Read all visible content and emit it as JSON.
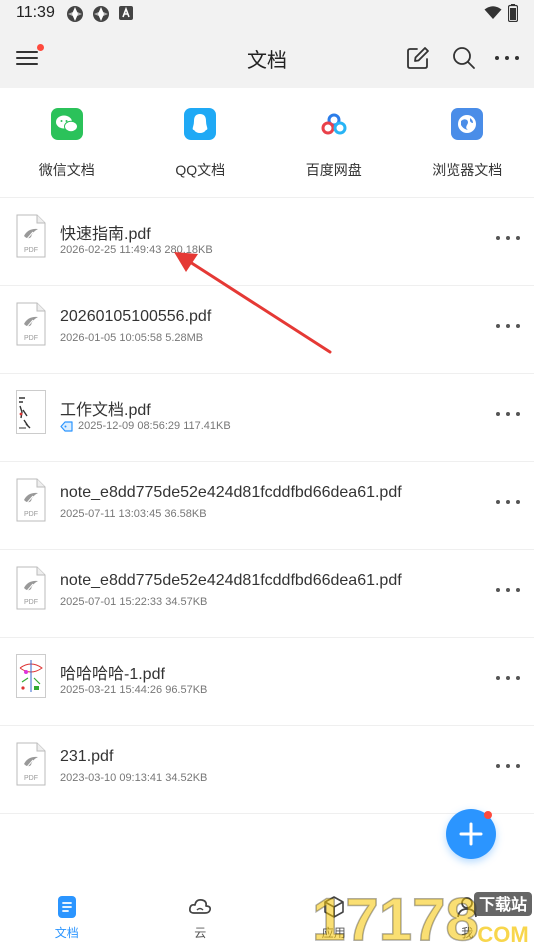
{
  "status_bar": {
    "time": "11:39",
    "left_icons": [
      "sync-icon",
      "sync-icon",
      "android-notification-icon"
    ],
    "right_icons": [
      "wifi-icon",
      "battery-icon"
    ]
  },
  "header": {
    "title": "文档",
    "actions": [
      "menu-icon",
      "edit-icon",
      "search-icon",
      "more-icon"
    ]
  },
  "sources": [
    {
      "label": "微信文档",
      "icon": "wechat-icon",
      "color": "#2bc25a"
    },
    {
      "label": "QQ文档",
      "icon": "qq-icon",
      "color": "#1fa9f5"
    },
    {
      "label": "百度网盘",
      "icon": "baidu-netdisk-icon",
      "color": "#ffffff"
    },
    {
      "label": "浏览器文档",
      "icon": "browser-icon",
      "color": "#4a8de8"
    }
  ],
  "files": [
    {
      "name": "快速指南.pdf",
      "meta": "2026-02-25 11:49:43 280.18KB",
      "thumb": "pdf-icon",
      "tagged": false
    },
    {
      "name": "20260105100556.pdf",
      "meta": "2026-01-05 10:05:58 5.28MB",
      "thumb": "pdf-icon",
      "tagged": false
    },
    {
      "name": "工作文档.pdf",
      "meta": "2025-12-09 08:56:29 117.41KB",
      "thumb": "document-preview",
      "tagged": true
    },
    {
      "name": "note_e8dd775de52e424d81fcddfbd66dea61.pdf",
      "meta": "2025-07-11 13:03:45 36.58KB",
      "thumb": "pdf-icon",
      "tagged": false
    },
    {
      "name": "note_e8dd775de52e424d81fcddfbd66dea61.pdf",
      "meta": "2025-07-01 15:22:33 34.57KB",
      "thumb": "pdf-icon",
      "tagged": false
    },
    {
      "name": "哈哈哈哈-1.pdf",
      "meta": "2025-03-21 15:44:26 96.57KB",
      "thumb": "drawing-preview",
      "tagged": false
    },
    {
      "name": "231.pdf",
      "meta": "2023-03-10 09:13:41 34.52KB",
      "thumb": "pdf-icon",
      "tagged": false
    }
  ],
  "pdf_badge": "PDF",
  "fab": {
    "icon": "plus-icon",
    "color": "#2b95ff"
  },
  "bottom_nav": [
    {
      "label": "文档",
      "icon": "document-icon",
      "active": true
    },
    {
      "label": "云",
      "icon": "cloud-icon",
      "active": false
    },
    {
      "label": "应用",
      "icon": "cube-icon",
      "active": false
    },
    {
      "label": "我",
      "icon": "user-icon",
      "active": false
    }
  ],
  "watermark": {
    "brand": "17178",
    "text": "下载站",
    "suffix": "COM"
  },
  "colors": {
    "accent": "#2b95ff",
    "arrow": "#e53935",
    "badge": "#ff4a3d"
  }
}
